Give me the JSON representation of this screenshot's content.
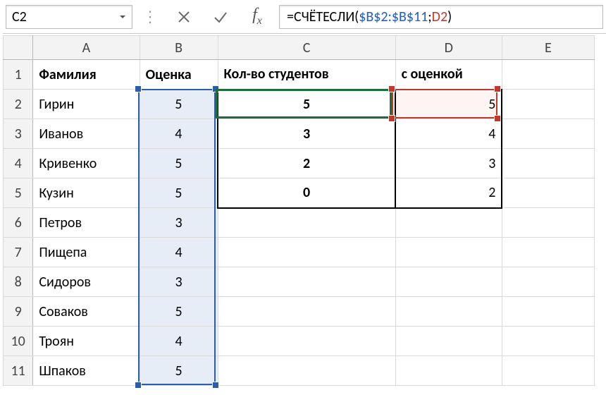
{
  "namebox": {
    "value": "C2"
  },
  "formula": {
    "prefix": "=СЧЁТЕСЛИ(",
    "ref1": "$B$2:$B$11",
    "sep": ";",
    "ref2": "D2",
    "suffix": ")"
  },
  "columns": {
    "A": "A",
    "B": "B",
    "C": "C",
    "D": "D",
    "E": "E"
  },
  "rows": [
    "1",
    "2",
    "3",
    "4",
    "5",
    "6",
    "7",
    "8",
    "9",
    "10",
    "11"
  ],
  "headers": {
    "A": "Фамилия",
    "B": "Оценка",
    "C": "Кол-во студентов",
    "D": "с оценкой"
  },
  "students": [
    {
      "name": "Гирин",
      "grade": "5"
    },
    {
      "name": "Иванов",
      "grade": "4"
    },
    {
      "name": "Кривенко",
      "grade": "5"
    },
    {
      "name": "Кузин",
      "grade": "5"
    },
    {
      "name": "Петров",
      "grade": "3"
    },
    {
      "name": "Пищепа",
      "grade": "4"
    },
    {
      "name": "Сидоров",
      "grade": "3"
    },
    {
      "name": "Соваков",
      "grade": "5"
    },
    {
      "name": "Троян",
      "grade": "4"
    },
    {
      "name": "Шпаков",
      "grade": "5"
    }
  ],
  "summary": [
    {
      "count": "5",
      "grade": "5"
    },
    {
      "count": "3",
      "grade": "4"
    },
    {
      "count": "2",
      "grade": "3"
    },
    {
      "count": "0",
      "grade": "2"
    }
  ],
  "chart_data": {
    "type": "table",
    "title": "Student grades and count per grade",
    "students_columns": [
      "Фамилия",
      "Оценка"
    ],
    "students_rows": [
      [
        "Гирин",
        5
      ],
      [
        "Иванов",
        4
      ],
      [
        "Кривенко",
        5
      ],
      [
        "Кузин",
        5
      ],
      [
        "Петров",
        3
      ],
      [
        "Пищепа",
        4
      ],
      [
        "Сидоров",
        3
      ],
      [
        "Соваков",
        5
      ],
      [
        "Троян",
        4
      ],
      [
        "Шпаков",
        5
      ]
    ],
    "summary_columns": [
      "Кол-во студентов",
      "с оценкой"
    ],
    "summary_rows": [
      [
        5,
        5
      ],
      [
        3,
        4
      ],
      [
        2,
        3
      ],
      [
        0,
        2
      ]
    ]
  }
}
